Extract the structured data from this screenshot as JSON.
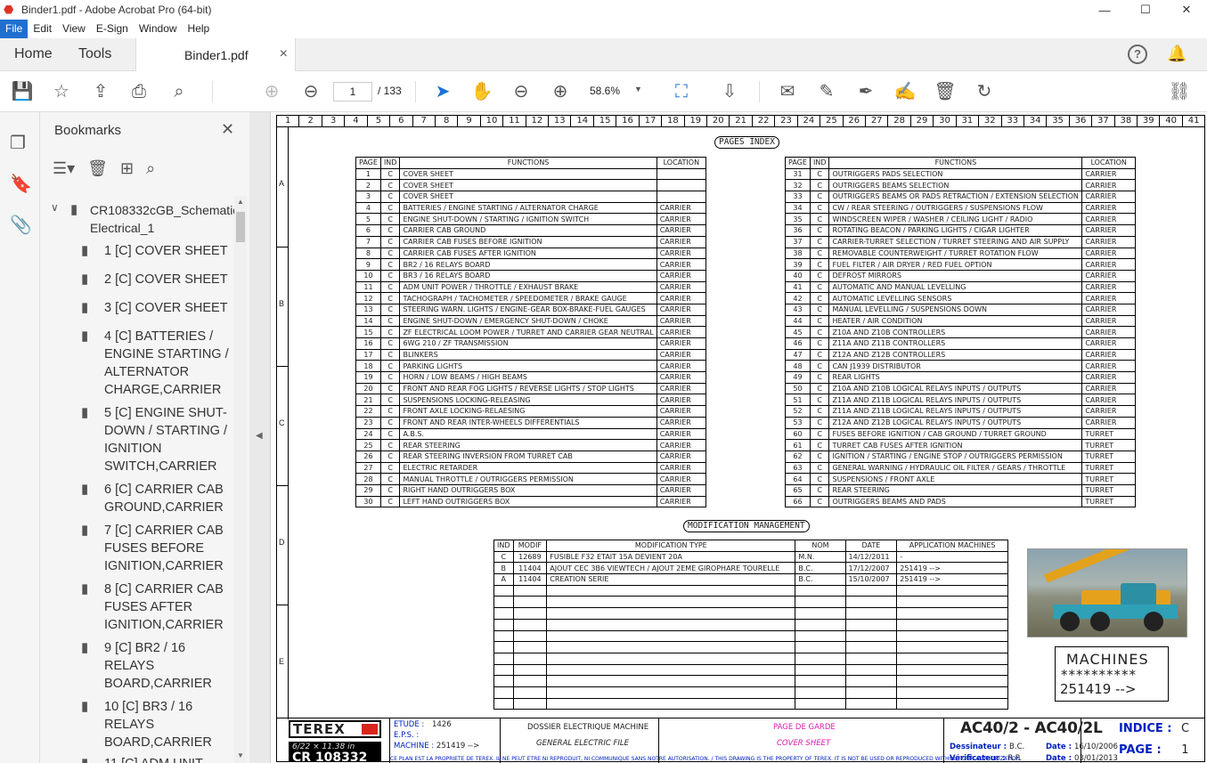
{
  "window": {
    "title": "Binder1.pdf - Adobe Acrobat Pro (64-bit)",
    "minimize": "—",
    "maximize": "☐",
    "close": "✕"
  },
  "menu": [
    "File",
    "Edit",
    "View",
    "E-Sign",
    "Window",
    "Help"
  ],
  "tabs": {
    "home": "Home",
    "tools": "Tools",
    "doc": "Binder1.pdf",
    "doc_close": "×"
  },
  "toolbar": {
    "page_current": "1",
    "page_total": "/ 133",
    "zoom": "58.6%"
  },
  "bookmarks": {
    "header": "Bookmarks",
    "root": "CR108332cGB_Schematic Electrical_1",
    "items": [
      "1 [C] COVER SHEET",
      "2 [C] COVER SHEET",
      "3 [C] COVER SHEET",
      "4 [C] BATTERIES / ENGINE STARTING / ALTERNATOR CHARGE,CARRIER",
      "5 [C] ENGINE SHUT-DOWN / STARTING / IGNITION SWITCH,CARRIER",
      "6 [C] CARRIER CAB GROUND,CARRIER",
      "7 [C] CARRIER CAB FUSES BEFORE IGNITION,CARRIER",
      "8 [C] CARRIER CAB FUSES AFTER IGNITION,CARRIER",
      "9 [C] BR2 / 16 RELAYS BOARD,CARRIER",
      "10 [C] BR3 / 16 RELAYS BOARD,CARRIER",
      "11 [C] ADM UNIT"
    ]
  },
  "sheet": {
    "ruler": [
      "1",
      "2",
      "3",
      "4",
      "5",
      "6",
      "7",
      "8",
      "9",
      "10",
      "11",
      "12",
      "13",
      "14",
      "15",
      "16",
      "17",
      "18",
      "19",
      "20",
      "21",
      "22",
      "23",
      "24",
      "25",
      "26",
      "27",
      "28",
      "29",
      "30",
      "31",
      "32",
      "33",
      "34",
      "35",
      "36",
      "37",
      "38",
      "39",
      "40",
      "41"
    ],
    "rows": [
      "A",
      "B",
      "C",
      "D",
      "E"
    ],
    "index_title": "PAGES INDEX",
    "headers": {
      "page": "PAGE",
      "ind": "IND",
      "functions": "FUNCTIONS",
      "location": "LOCATION"
    },
    "left_table": [
      [
        "1",
        "C",
        "COVER SHEET",
        ""
      ],
      [
        "2",
        "C",
        "COVER SHEET",
        ""
      ],
      [
        "3",
        "C",
        "COVER SHEET",
        ""
      ],
      [
        "4",
        "C",
        "BATTERIES / ENGINE STARTING / ALTERNATOR CHARGE",
        "CARRIER"
      ],
      [
        "5",
        "C",
        "ENGINE SHUT-DOWN / STARTING / IGNITION SWITCH",
        "CARRIER"
      ],
      [
        "6",
        "C",
        "CARRIER CAB GROUND",
        "CARRIER"
      ],
      [
        "7",
        "C",
        "CARRIER CAB FUSES BEFORE IGNITION",
        "CARRIER"
      ],
      [
        "8",
        "C",
        "CARRIER CAB FUSES AFTER IGNITION",
        "CARRIER"
      ],
      [
        "9",
        "C",
        "BR2 / 16 RELAYS BOARD",
        "CARRIER"
      ],
      [
        "10",
        "C",
        "BR3 / 16 RELAYS BOARD",
        "CARRIER"
      ],
      [
        "11",
        "C",
        "ADM UNIT POWER / THROTTLE / EXHAUST BRAKE",
        "CARRIER"
      ],
      [
        "12",
        "C",
        "TACHOGRAPH / TACHOMETER / SPEEDOMETER / BRAKE GAUGE",
        "CARRIER"
      ],
      [
        "13",
        "C",
        "STEERING WARN. LIGHTS / ENGINE-GEAR BOX-BRAKE-FUEL GAUGES",
        "CARRIER"
      ],
      [
        "14",
        "C",
        "ENGINE SHUT-DOWN / EMERGENCY SHUT-DOWN / CHOKE",
        "CARRIER"
      ],
      [
        "15",
        "C",
        "ZF ELECTRICAL LOOM POWER / TURRET AND CARRIER GEAR NEUTRAL",
        "CARRIER"
      ],
      [
        "16",
        "C",
        "6WG 210 / ZF TRANSMISSION",
        "CARRIER"
      ],
      [
        "17",
        "C",
        "BLINKERS",
        "CARRIER"
      ],
      [
        "18",
        "C",
        "PARKING LIGHTS",
        "CARRIER"
      ],
      [
        "19",
        "C",
        "HORN / LOW BEAMS / HIGH BEAMS",
        "CARRIER"
      ],
      [
        "20",
        "C",
        "FRONT AND REAR FOG LIGHTS / REVERSE LIGHTS / STOP LIGHTS",
        "CARRIER"
      ],
      [
        "21",
        "C",
        "SUSPENSIONS LOCKING-RELEASING",
        "CARRIER"
      ],
      [
        "22",
        "C",
        "FRONT AXLE LOCKING-RELAESING",
        "CARRIER"
      ],
      [
        "23",
        "C",
        "FRONT AND REAR INTER-WHEELS DIFFERENTIALS",
        "CARRIER"
      ],
      [
        "24",
        "C",
        "A.B.S.",
        "CARRIER"
      ],
      [
        "25",
        "C",
        "REAR STEERING",
        "CARRIER"
      ],
      [
        "26",
        "C",
        "REAR STEERING INVERSION FROM TURRET CAB",
        "CARRIER"
      ],
      [
        "27",
        "C",
        "ELECTRIC RETARDER",
        "CARRIER"
      ],
      [
        "28",
        "C",
        "MANUAL THROTTLE / OUTRIGGERS PERMISSION",
        "CARRIER"
      ],
      [
        "29",
        "C",
        "RIGHT HAND OUTRIGGERS BOX",
        "CARRIER"
      ],
      [
        "30",
        "C",
        "LEFT HAND OUTRIGGERS BOX",
        "CARRIER"
      ]
    ],
    "right_table": [
      [
        "31",
        "C",
        "OUTRIGGERS PADS SELECTION",
        "CARRIER"
      ],
      [
        "32",
        "C",
        "OUTRIGGERS BEAMS SELECTION",
        "CARRIER"
      ],
      [
        "33",
        "C",
        "OUTRIGGERS BEAMS OR PADS RETRACTION / EXTENSION SELECTION",
        "CARRIER"
      ],
      [
        "34",
        "C",
        "CW / REAR STEERING / OUTRIGGERS / SUSPENSIONS FLOW",
        "CARRIER"
      ],
      [
        "35",
        "C",
        "WINDSCREEN WIPER / WASHER / CEILING LIGHT / RADIO",
        "CARRIER"
      ],
      [
        "36",
        "C",
        "ROTATING BEACON / PARKING LIGHTS / CIGAR LIGHTER",
        "CARRIER"
      ],
      [
        "37",
        "C",
        "CARRIER-TURRET SELECTION / TURRET STEERING AND AIR SUPPLY",
        "CARRIER"
      ],
      [
        "38",
        "C",
        "REMOVABLE COUNTERWEIGHT / TURRET ROTATION FLOW",
        "CARRIER"
      ],
      [
        "39",
        "C",
        "FUEL FILTER / AIR DRYER / RED FUEL OPTION",
        "CARRIER"
      ],
      [
        "40",
        "C",
        "DEFROST MIRRORS",
        "CARRIER"
      ],
      [
        "41",
        "C",
        "AUTOMATIC AND MANUAL LEVELLING",
        "CARRIER"
      ],
      [
        "42",
        "C",
        "AUTOMATIC LEVELLING SENSORS",
        "CARRIER"
      ],
      [
        "43",
        "C",
        "MANUAL LEVELLING / SUSPENSIONS DOWN",
        "CARRIER"
      ],
      [
        "44",
        "C",
        "HEATER / AIR CONDITION",
        "CARRIER"
      ],
      [
        "45",
        "C",
        "Z10A AND Z10B CONTROLLERS",
        "CARRIER"
      ],
      [
        "46",
        "C",
        "Z11A AND Z11B CONTROLLERS",
        "CARRIER"
      ],
      [
        "47",
        "C",
        "Z12A AND Z12B CONTROLLERS",
        "CARRIER"
      ],
      [
        "48",
        "C",
        "CAN J1939 DISTRIBUTOR",
        "CARRIER"
      ],
      [
        "49",
        "C",
        "REAR LIGHTS",
        "CARRIER"
      ],
      [
        "50",
        "C",
        "Z10A AND Z10B LOGICAL RELAYS INPUTS / OUTPUTS",
        "CARRIER"
      ],
      [
        "51",
        "C",
        "Z11A AND Z11B LOGICAL RELAYS INPUTS / OUTPUTS",
        "CARRIER"
      ],
      [
        "52",
        "C",
        "Z11A AND Z11B LOGICAL RELAYS INPUTS / OUTPUTS",
        "CARRIER"
      ],
      [
        "53",
        "C",
        "Z12A AND Z12B LOGICAL RELAYS INPUTS / OUTPUTS",
        "CARRIER"
      ],
      [
        "60",
        "C",
        "FUSES BEFORE IGNITION / CAB GROUND / TURRET GROUND",
        "TURRET"
      ],
      [
        "61",
        "C",
        "TURRET CAB FUSES AFTER IGNITION",
        "TURRET"
      ],
      [
        "62",
        "C",
        "IGNITION / STARTING / ENGINE STOP / OUTRIGGERS PERMISSION",
        "TURRET"
      ],
      [
        "63",
        "C",
        "GENERAL WARNING / HYDRAULIC OIL FILTER / GEARS / THROTTLE",
        "TURRET"
      ],
      [
        "64",
        "C",
        "SUSPENSIONS / FRONT AXLE",
        "TURRET"
      ],
      [
        "65",
        "C",
        "REAR STEERING",
        "TURRET"
      ],
      [
        "66",
        "C",
        "OUTRIGGERS BEAMS AND PADS",
        "TURRET"
      ]
    ],
    "mod_title": "MODIFICATION MANAGEMENT",
    "mod_headers": [
      "IND",
      "MODIF",
      "MODIFICATION TYPE",
      "NOM",
      "DATE",
      "APPLICATION MACHINES"
    ],
    "mod_rows": [
      [
        "C",
        "12689",
        "FUSIBLE F32 ETAIT 15A DEVIENT 20A",
        "M.N.",
        "14/12/2011",
        "-"
      ],
      [
        "B",
        "11404",
        "AJOUT CEC 3B6 VIEWTECH / AJOUT 2EME GIROPHARE TOURELLE",
        "B.C.",
        "17/12/2007",
        "251419 -->"
      ],
      [
        "A",
        "11404",
        "CREATION SERIE",
        "B.C.",
        "15/10/2007",
        "251419 -->"
      ]
    ],
    "machines": {
      "label": "MACHINES",
      "stars": "**********",
      "value": "251419 -->"
    },
    "title_block": {
      "brand": "TEREX",
      "cr": "CR 108332",
      "overlay": "6/22 × 11.38 in",
      "etude_label": "ETUDE :",
      "etude_value": "1426",
      "eps_label": "E.P.S. :",
      "machine_label": "MACHINE :",
      "machine_value": "251419 -->",
      "dossier": "DOSSIER ELECTRIQUE MACHINE",
      "general": "GENERAL ELECTRIC FILE",
      "page_de_garde": "PAGE DE GARDE",
      "cover_sheet": "COVER SHEET",
      "model": "AC40/2 - AC40/2L",
      "dessinateur_label": "Dessinateur :",
      "dessinateur_value": "B.C.",
      "verificateur_label": "Vérificateur :",
      "verificateur_value": "R.P.",
      "date_label": "Date :",
      "date1": "16/10/2006",
      "date2": "03/01/2013",
      "indice_label": "INDICE :",
      "indice_value": "C",
      "page_label": "PAGE :",
      "page_value": "1",
      "disclaimer": "CE PLAN EST LA PROPRIETE DE TEREX. IL NE PEUT ETRE NI REPRODUIT, NI COMMUNIQUE SANS NOTRE AUTORISATION. / THIS DRAWING IS THE PROPERTY OF TEREX. IT IS NOT BE USED OR REPRODUCED WITHOUT OUR AUTHORIZATION."
    }
  }
}
